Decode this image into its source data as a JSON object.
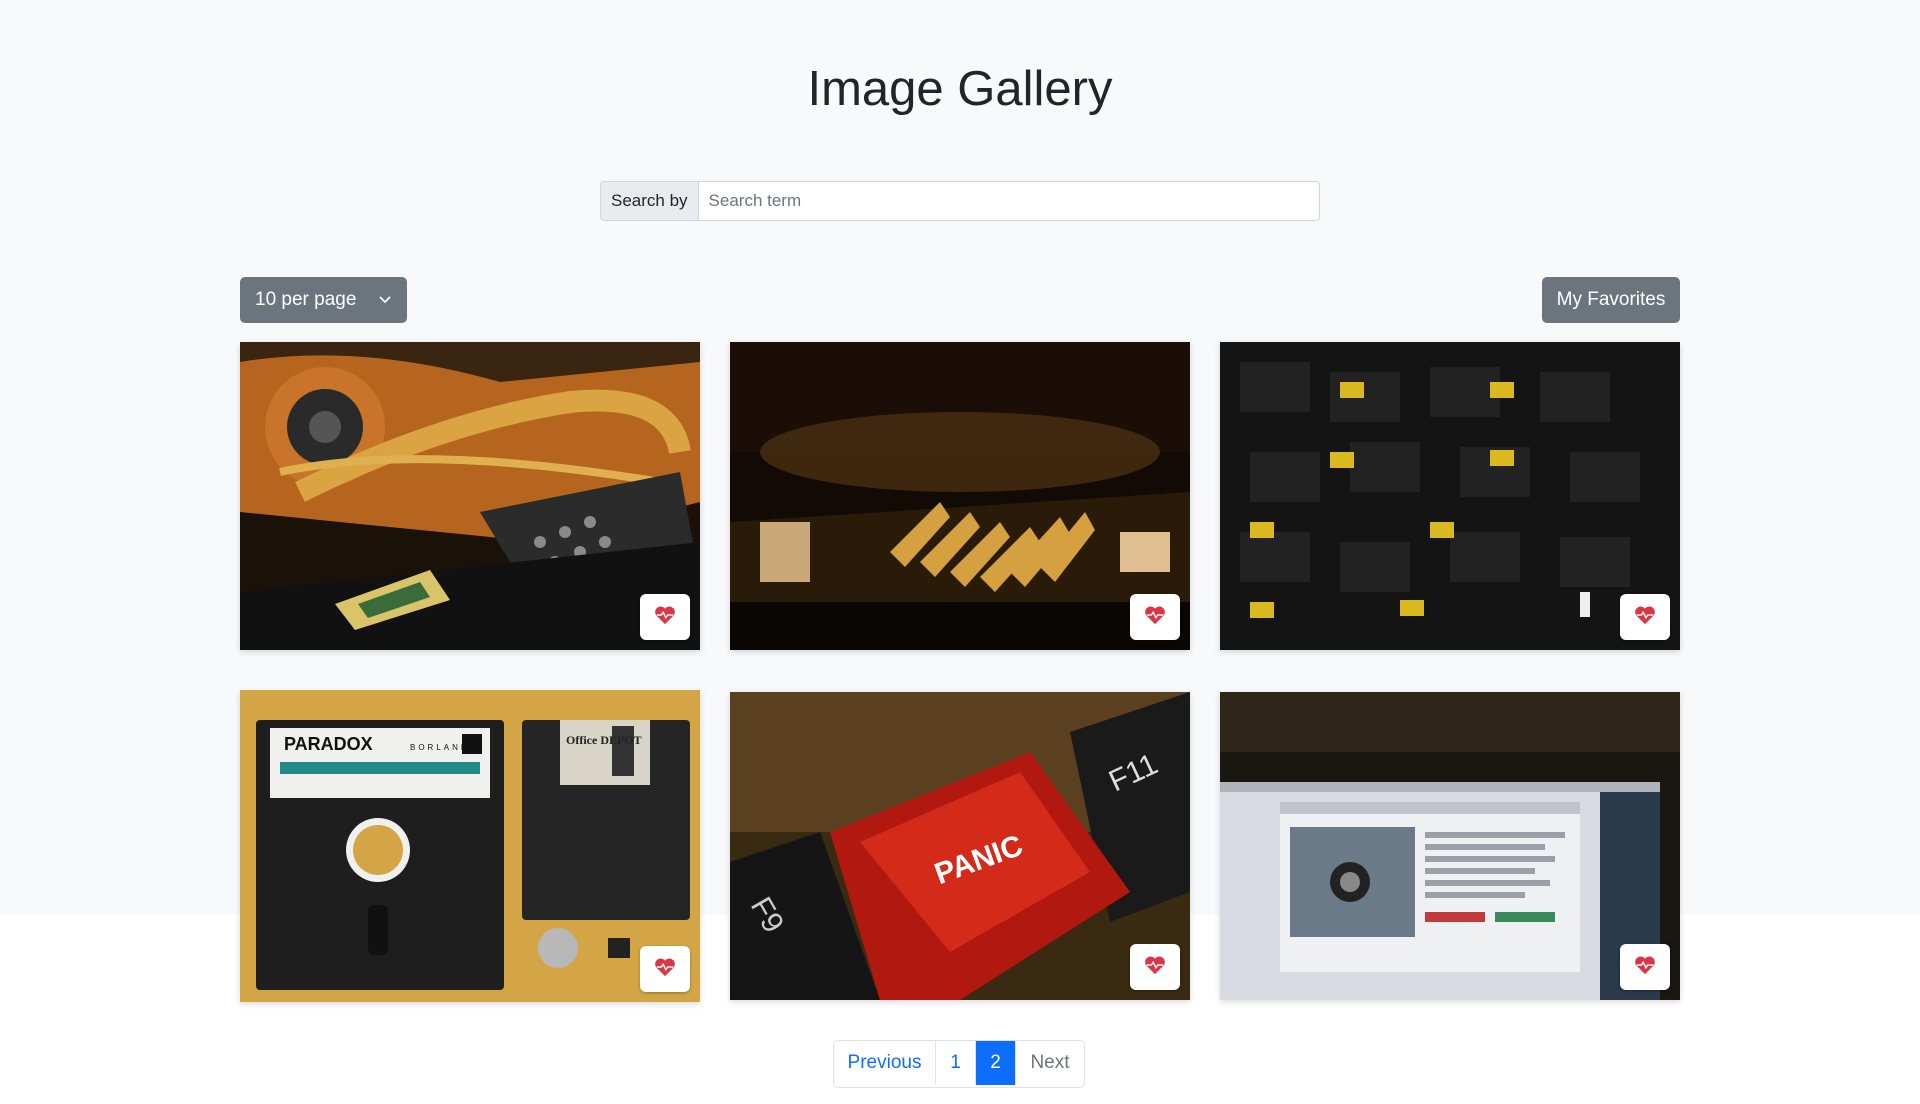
{
  "title": "Image Gallery",
  "search": {
    "label": "Search by",
    "placeholder": "Search term",
    "value": ""
  },
  "per_page": {
    "selected": "10 per page"
  },
  "favorites_label": "My Favorites",
  "colors": {
    "accent": "#0d6efd",
    "secondary": "#6c757d",
    "heart": "#dc3545"
  },
  "gallery": {
    "images": [
      {
        "subject": "laptop heatsink and CPU",
        "favorite_icon": "heart-pulse-icon"
      },
      {
        "subject": "motherboard gold heatsink",
        "favorite_icon": "heart-pulse-icon"
      },
      {
        "subject": "memory chips circuit board",
        "favorite_icon": "heart-pulse-icon"
      },
      {
        "subject": "floppy disks and coin",
        "favorite_icon": "heart-pulse-icon"
      },
      {
        "subject": "PANIC keyboard key",
        "favorite_icon": "heart-pulse-icon"
      },
      {
        "subject": "laptop screen with browser",
        "favorite_icon": "heart-pulse-icon"
      }
    ],
    "disk_label": "PARADOX",
    "disk_brand": "BORLAND",
    "disk2_label": "Office DEPOT",
    "key_label": "PANIC",
    "key_f11": "F11",
    "key_f9": "F9"
  },
  "pagination": {
    "previous": "Previous",
    "pages": [
      "1",
      "2"
    ],
    "current": "2",
    "next": "Next"
  }
}
